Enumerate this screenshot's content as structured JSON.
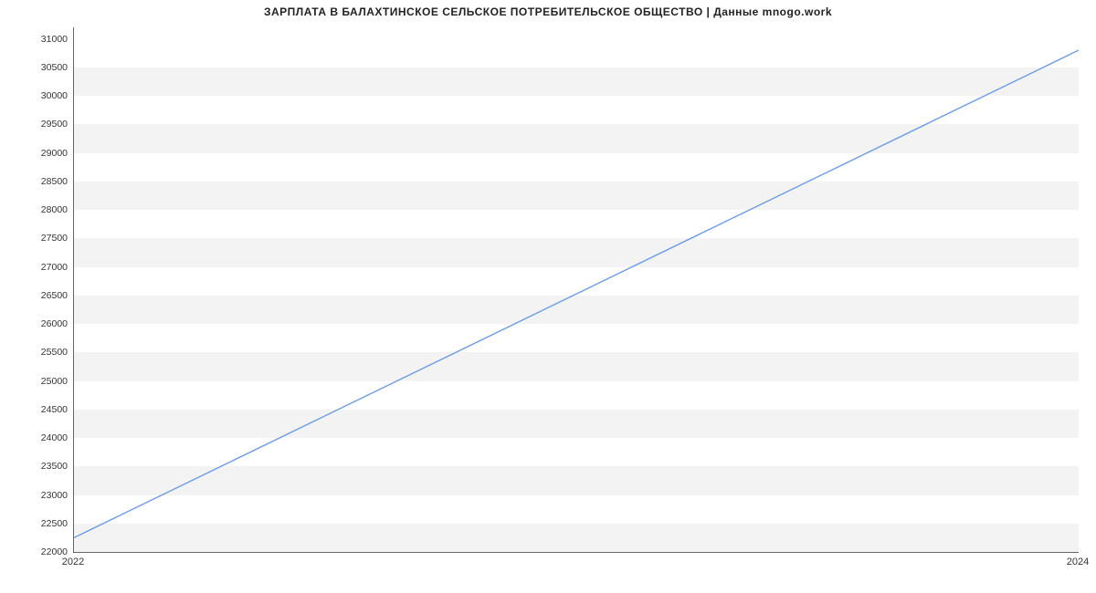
{
  "chart_data": {
    "type": "line",
    "title": "ЗАРПЛАТА В БАЛАХТИНСКОЕ СЕЛЬСКОЕ ПОТРЕБИТЕЛЬСКОЕ ОБЩЕСТВО | Данные mnogo.work",
    "xlabel": "",
    "ylabel": "",
    "x": [
      2022,
      2024
    ],
    "values": [
      22250,
      30800
    ],
    "x_ticks": [
      2022,
      2024
    ],
    "y_ticks": [
      22000,
      22500,
      23000,
      23500,
      24000,
      24500,
      25000,
      25500,
      26000,
      26500,
      27000,
      27500,
      28000,
      28500,
      29000,
      29500,
      30000,
      30500,
      31000
    ],
    "xlim": [
      2022,
      2024
    ],
    "ylim": [
      22000,
      31200
    ],
    "line_color": "#6b9be8"
  }
}
